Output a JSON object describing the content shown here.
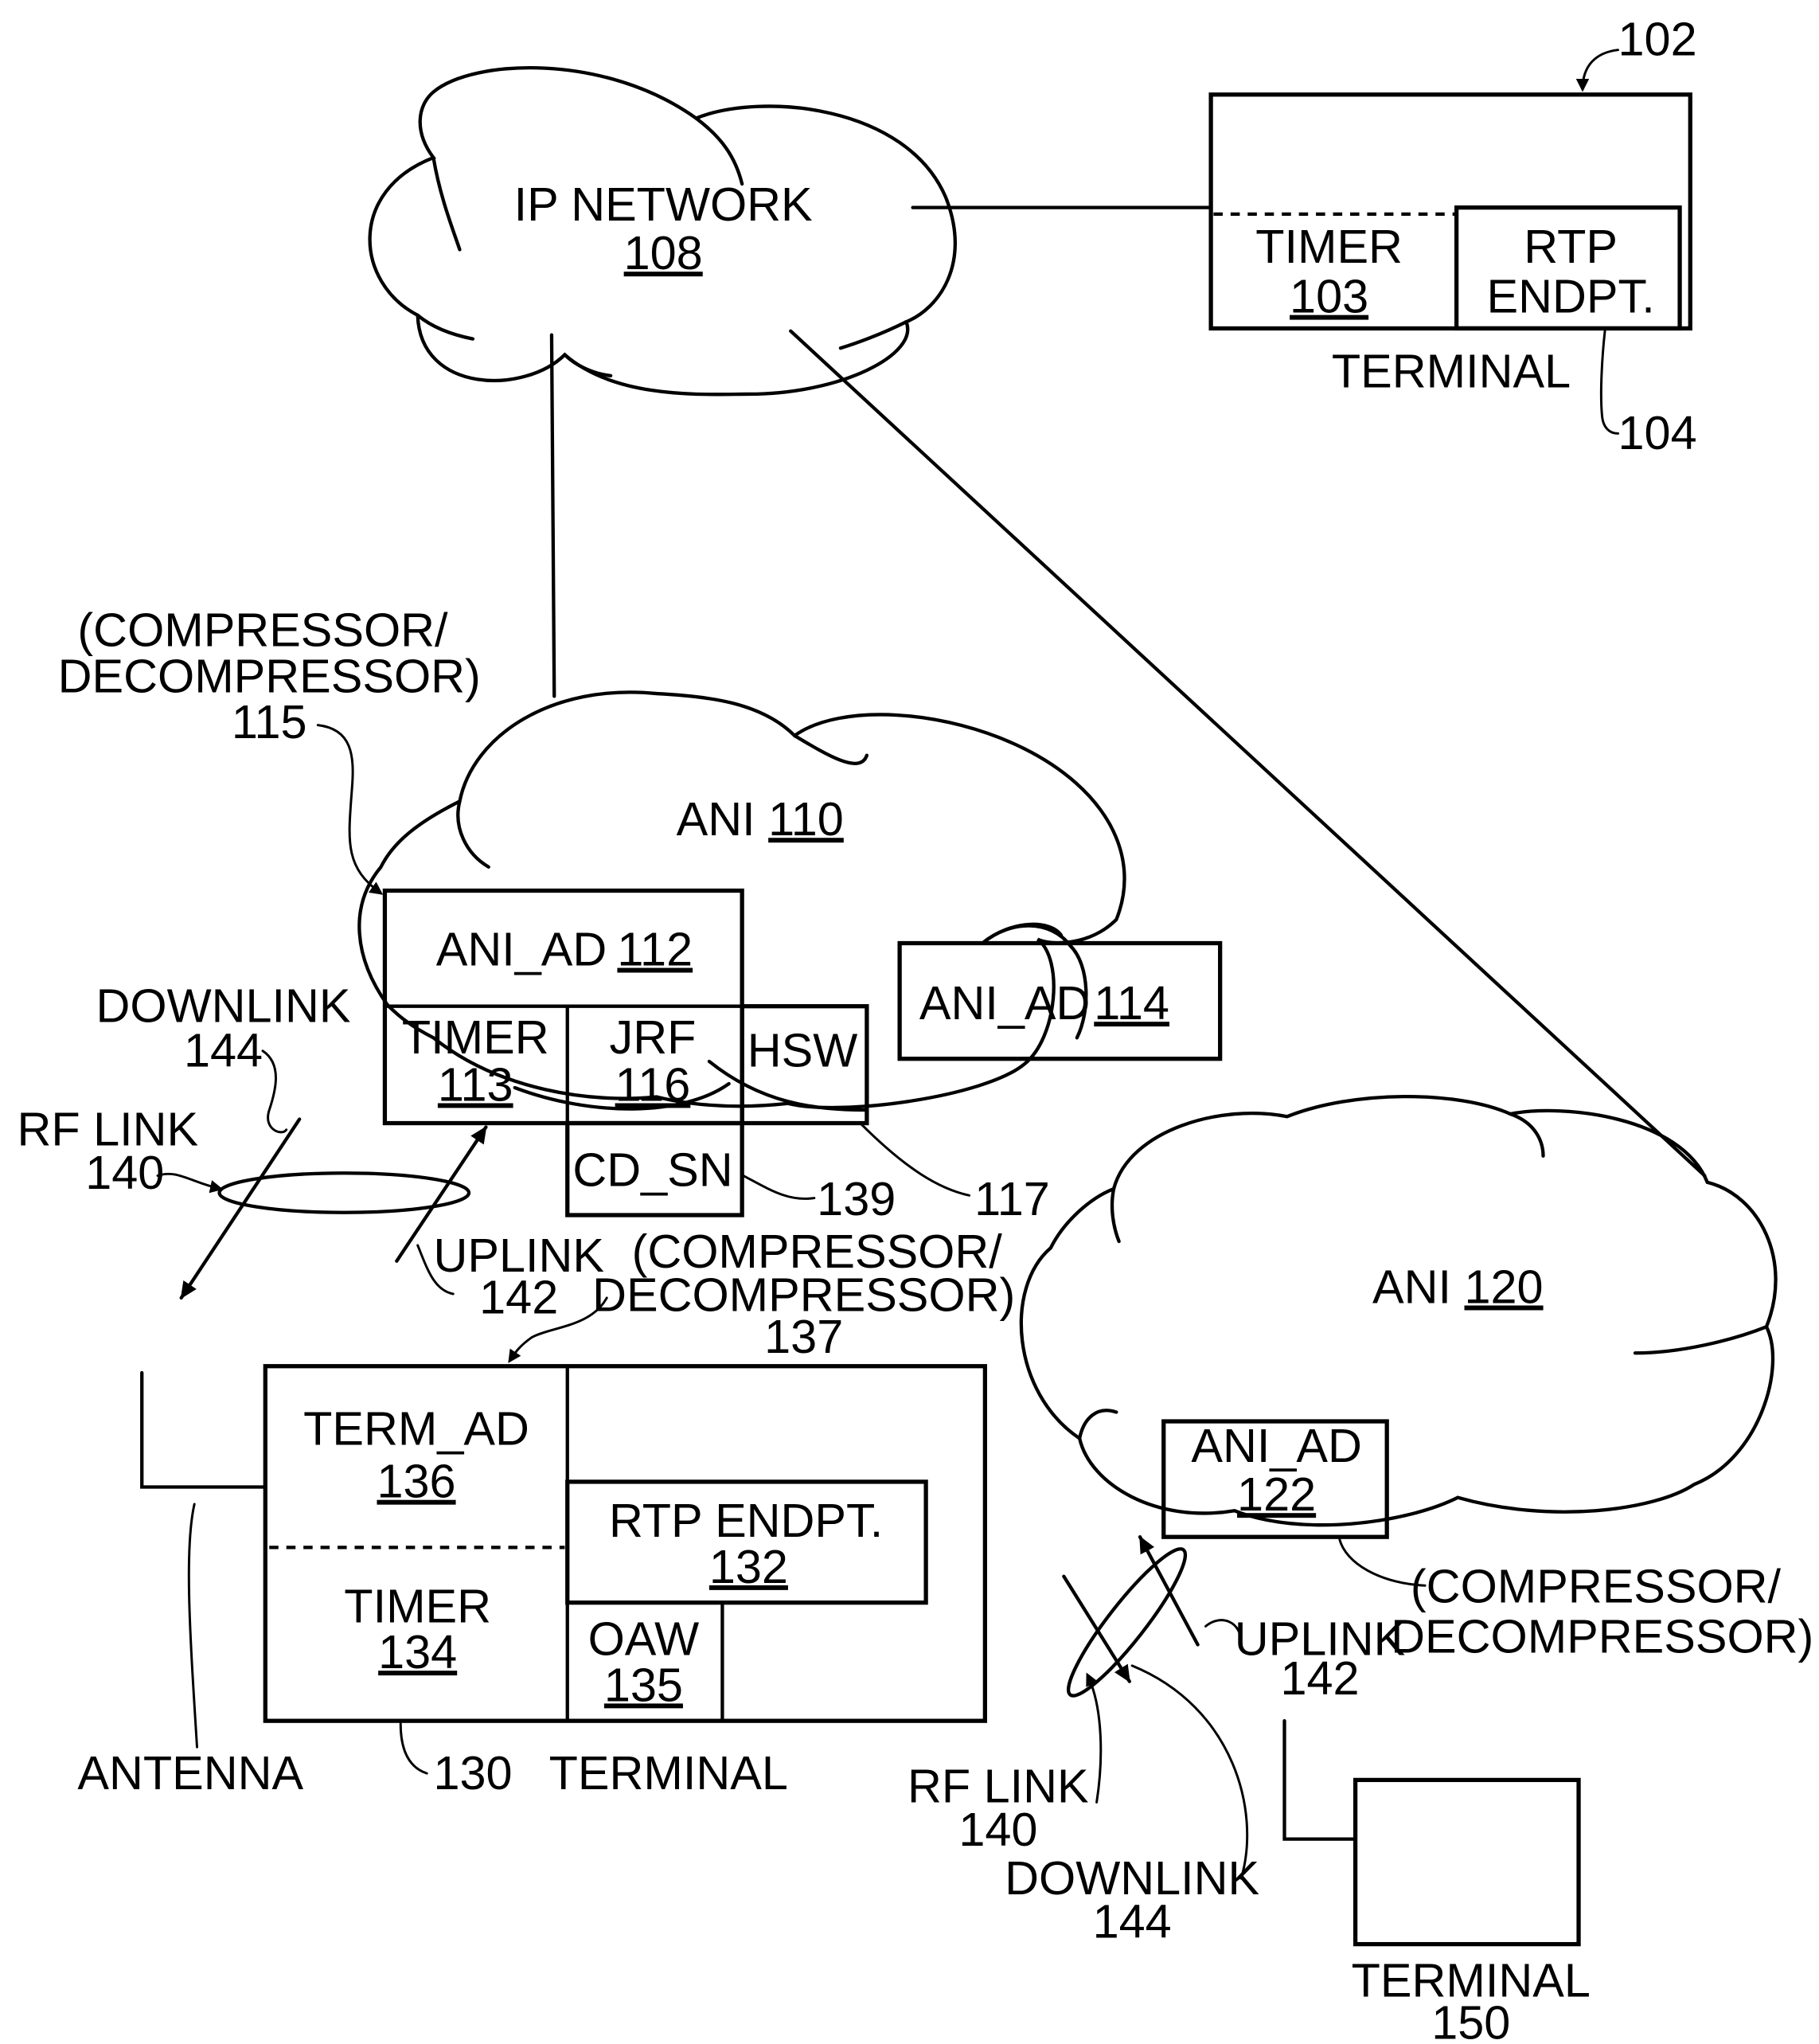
{
  "figure": {
    "ip_network": {
      "name": "IP NETWORK",
      "ref": "108"
    },
    "terminal_102": {
      "ref": "102",
      "timer": "TIMER",
      "timer_ref": "103",
      "rtp_line1": "RTP",
      "rtp_line2": "ENDPT.",
      "label": "TERMINAL",
      "rtp_ref": "104"
    },
    "ani_110": {
      "name": "ANI",
      "ref": "110"
    },
    "ani_ad_112": {
      "name": "ANI_AD",
      "ref": "112",
      "timer": "TIMER",
      "timer_ref": "113",
      "jrf": "JRF",
      "jrf_ref": "116",
      "hsw": "HSW",
      "cd_sn": "CD_SN",
      "cd_sn_ref": "139",
      "hsw_ref": "117"
    },
    "compressor_115": {
      "line1": "(COMPRESSOR/",
      "line2": "DECOMPRESSOR)",
      "ref": "115"
    },
    "ani_ad_114": {
      "name": "ANI_AD",
      "ref": "114"
    },
    "ani_120": {
      "name": "ANI",
      "ref": "120"
    },
    "ani_ad_122": {
      "name": "ANI_AD",
      "ref": "122",
      "comp_line1": "(COMPRESSOR/",
      "comp_line2": "DECOMPRESSOR)"
    },
    "left_links": {
      "downlink": "DOWNLINK",
      "downlink_ref": "144",
      "rf_link": "RF LINK",
      "rf_link_ref": "140",
      "uplink": "UPLINK",
      "uplink_ref": "142"
    },
    "compressor_137": {
      "line1": "(COMPRESSOR/",
      "line2": "DECOMPRESSOR)",
      "ref": "137"
    },
    "terminal_130": {
      "term_ad": "TERM_AD",
      "term_ad_ref": "136",
      "timer": "TIMER",
      "timer_ref": "134",
      "rtp": "RTP ENDPT.",
      "rtp_ref": "132",
      "oaw": "OAW",
      "oaw_ref": "135",
      "ref": "130",
      "label": "TERMINAL",
      "antenna": "ANTENNA"
    },
    "right_links": {
      "uplink": "UPLINK",
      "uplink_ref": "142",
      "rf_link": "RF LINK",
      "rf_link_ref": "140",
      "downlink": "DOWNLINK",
      "downlink_ref": "144"
    },
    "terminal_150": {
      "label": "TERMINAL",
      "ref": "150"
    }
  }
}
